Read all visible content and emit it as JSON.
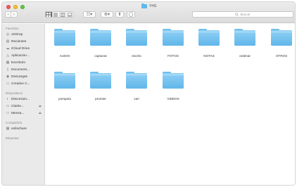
{
  "window": {
    "title": "YHS"
  },
  "toolbar": {
    "back_label": "‹",
    "forward_label": "›",
    "arrange_label": "☷▾",
    "action_label": "⚙▾",
    "share_label": "⬆",
    "tag_label": "◯",
    "search_placeholder": "Buscar"
  },
  "sidebar": {
    "favorites_header": "Favoritos",
    "favorites": [
      {
        "label": "AirDrop",
        "icon": "airdrop-icon"
      },
      {
        "label": "Recientes",
        "icon": "recents-icon"
      },
      {
        "label": "iCloud Drive",
        "icon": "cloud-icon"
      },
      {
        "label": "Aplicacion...",
        "icon": "applications-icon"
      },
      {
        "label": "Escritorio",
        "icon": "desktop-icon"
      },
      {
        "label": "Document...",
        "icon": "documents-icon"
      },
      {
        "label": "Descargas",
        "icon": "downloads-icon"
      },
      {
        "label": "Creative C...",
        "icon": "folder-icon"
      }
    ],
    "devices_header": "Dispositivos",
    "devices": [
      {
        "label": "Discorram...",
        "icon": "disk-icon"
      },
      {
        "label": "Clarke...",
        "icon": "drive-icon",
        "eject": "⏏"
      },
      {
        "label": "Mensa...",
        "icon": "drive-icon",
        "eject": "⏏"
      }
    ],
    "shared_header": "Compartido",
    "shared": [
      {
        "label": "enlischare",
        "icon": "network-icon"
      }
    ],
    "tags_header": "Etiquetas"
  },
  "folders": [
    {
      "name": "AUDIO"
    },
    {
      "name": "capturas"
    },
    {
      "name": "escrito"
    },
    {
      "name": "FOTOS"
    },
    {
      "name": "NOTAS"
    },
    {
      "name": "ordenar"
    },
    {
      "name": "OTROS"
    },
    {
      "name": "pompeta"
    },
    {
      "name": "promter"
    },
    {
      "name": "vari"
    },
    {
      "name": "VIDEOS"
    }
  ],
  "colors": {
    "folder": "#61b6e9",
    "sidebar": "#eaeaea",
    "accent": "#5fb8ec"
  }
}
